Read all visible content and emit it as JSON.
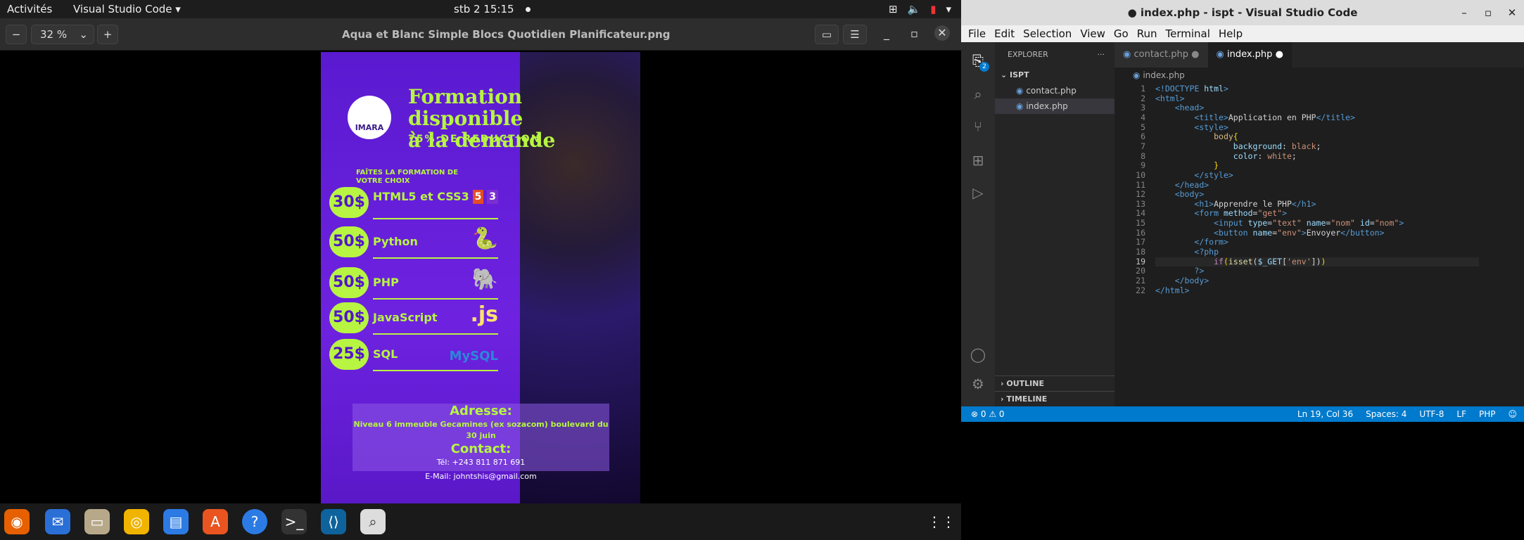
{
  "topbar": {
    "activities": "Activités",
    "app": "Visual Studio Code",
    "clock": "stb 2  15:15"
  },
  "viewer": {
    "zoom": "32 %",
    "title": "Aqua et Blanc Simple Blocs Quotidien Planificateur.png",
    "poster": {
      "logo_text": "IMARA",
      "headline_line1": "Formation disponible",
      "headline_line2": "à la demande",
      "reduction": "75% DE REDUCTION",
      "faites": "FAÎTES LA FORMATION DE VOTRE CHOIX",
      "courses": [
        {
          "price": "30$",
          "name": "HTML5 et CSS3",
          "icon": "html5-css3-icon"
        },
        {
          "price": "50$",
          "name": "Python",
          "icon": "python-icon"
        },
        {
          "price": "50$",
          "name": "PHP",
          "icon": "php-elephant-icon"
        },
        {
          "price": "50$",
          "name": "JavaScript",
          "icon": ".js"
        },
        {
          "price": "25$",
          "name": "SQL",
          "icon": "MySQL"
        }
      ],
      "adresse_label": "Adresse:",
      "adresse": "Niveau 6 immeuble Gecamines (ex sozacom) boulevard du 30 juin",
      "contact_label": "Contact:",
      "tel": "Tél: +243 811 871 691",
      "email": "E-Mail: johntshis@gmail.com"
    }
  },
  "vscode": {
    "title": "● index.php - ispt - Visual Studio Code",
    "menu": [
      "File",
      "Edit",
      "Selection",
      "View",
      "Go",
      "Run",
      "Terminal",
      "Help"
    ],
    "explorer_label": "EXPLORER",
    "folder": "ISPT",
    "files": [
      "contact.php",
      "index.php"
    ],
    "outline": "OUTLINE",
    "timeline": "TIMELINE",
    "tabs": [
      "contact.php",
      "index.php"
    ],
    "breadcrumb": "index.php",
    "status": {
      "problems": "⊗ 0 ⚠ 0",
      "position": "Ln 19, Col 36",
      "spaces": "Spaces: 4",
      "encoding": "UTF-8",
      "eol": "LF",
      "language": "PHP"
    },
    "badge": "2"
  }
}
